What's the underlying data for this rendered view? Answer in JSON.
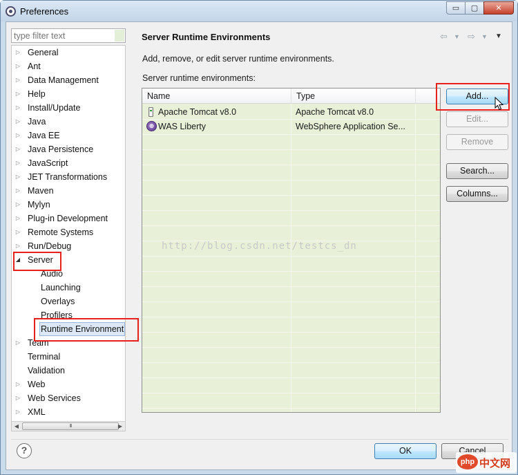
{
  "window": {
    "title": "Preferences",
    "minimize": "▭",
    "maximize": "▢",
    "close": "✕"
  },
  "filter": {
    "placeholder": "type filter text",
    "value": ""
  },
  "tree": {
    "items": [
      {
        "label": "General",
        "expandable": true
      },
      {
        "label": "Ant",
        "expandable": true
      },
      {
        "label": "Data Management",
        "expandable": true
      },
      {
        "label": "Help",
        "expandable": true
      },
      {
        "label": "Install/Update",
        "expandable": true
      },
      {
        "label": "Java",
        "expandable": true
      },
      {
        "label": "Java EE",
        "expandable": true
      },
      {
        "label": "Java Persistence",
        "expandable": true
      },
      {
        "label": "JavaScript",
        "expandable": true
      },
      {
        "label": "JET Transformations",
        "expandable": true
      },
      {
        "label": "Maven",
        "expandable": true
      },
      {
        "label": "Mylyn",
        "expandable": true
      },
      {
        "label": "Plug-in Development",
        "expandable": true
      },
      {
        "label": "Remote Systems",
        "expandable": true
      },
      {
        "label": "Run/Debug",
        "expandable": true
      },
      {
        "label": "Server",
        "expandable": true,
        "expanded": true
      },
      {
        "label": "Audio",
        "child": true
      },
      {
        "label": "Launching",
        "child": true
      },
      {
        "label": "Overlays",
        "child": true
      },
      {
        "label": "Profilers",
        "child": true
      },
      {
        "label": "Runtime Environment",
        "child": true,
        "selected": true
      },
      {
        "label": "Team",
        "expandable": true
      },
      {
        "label": "Terminal",
        "expandable": false
      },
      {
        "label": "Validation",
        "expandable": false
      },
      {
        "label": "Web",
        "expandable": true
      },
      {
        "label": "Web Services",
        "expandable": true
      },
      {
        "label": "XML",
        "expandable": true
      }
    ],
    "scrollbar_grip": "III"
  },
  "page": {
    "title": "Server Runtime Environments",
    "description": "Add, remove, or edit server runtime environments.",
    "list_label": "Server runtime environments:"
  },
  "table": {
    "columns": [
      "Name",
      "Type"
    ],
    "rows": [
      {
        "name": "Apache Tomcat v8.0",
        "type": "Apache Tomcat v8.0",
        "icon": "tomcat-icon"
      },
      {
        "name": "WAS Liberty",
        "type": "WebSphere Application Se...",
        "icon": "liberty-icon"
      }
    ]
  },
  "buttons": {
    "add": "Add...",
    "edit": "Edit...",
    "remove": "Remove",
    "search": "Search...",
    "columns": "Columns...",
    "ok": "OK",
    "cancel": "Cancel"
  },
  "watermark": "http://blog.csdn.net/testcs_dn",
  "brand": {
    "logo": "php",
    "text": "中文网"
  },
  "colors": {
    "annotation": "#e8201c",
    "table_bg": "#e8f0d8",
    "selection": "#dde8f6"
  }
}
